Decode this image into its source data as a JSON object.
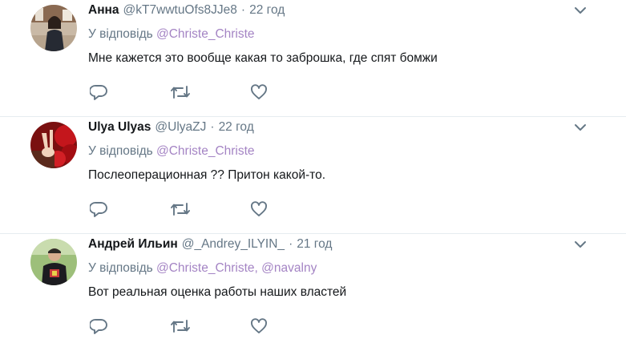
{
  "colors": {
    "name": "#14171a",
    "meta": "#657786",
    "mention": "#a484c4",
    "icon": "#657786",
    "divider": "#e6ecf0"
  },
  "icons": {
    "reply": "reply-icon",
    "retweet": "retweet-icon",
    "like": "heart-icon",
    "menu": "chevron-down-icon"
  },
  "tweets": [
    {
      "name": "Анна",
      "handle": "@kT7wwtuOfs8JJe8",
      "sep": "·",
      "time": "22 год",
      "reply_prefix": "У відповідь",
      "mentions": [
        "@Christe_Christe"
      ],
      "text": "Мне кажется это вообще какая то заброшка, где спят бомжи"
    },
    {
      "name": "Ulya Ulyas",
      "handle": "@UlyaZJ",
      "sep": "·",
      "time": "22 год",
      "reply_prefix": "У відповідь",
      "mentions": [
        "@Christe_Christe"
      ],
      "text": "Послеоперационная ?? Притон какой-то."
    },
    {
      "name": "Андрей Ильин",
      "handle": "@_Andrey_ILYIN_",
      "sep": "·",
      "time": "21 год",
      "reply_prefix": "У відповідь",
      "mentions": [
        "@Christe_Christe,",
        "@navalny"
      ],
      "text": "Вот реальная оценка работы наших властей"
    }
  ]
}
